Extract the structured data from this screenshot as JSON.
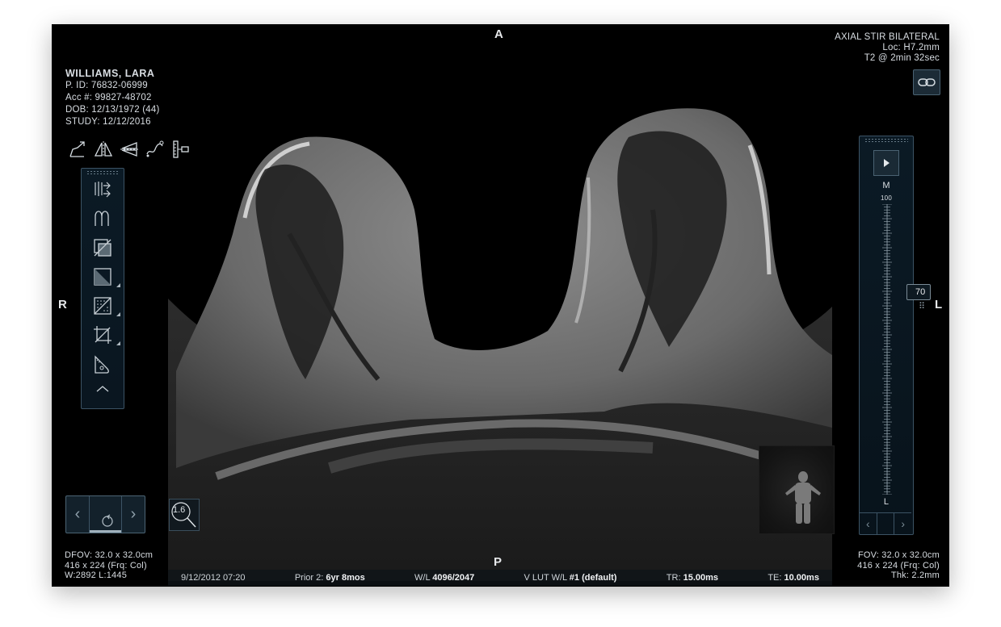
{
  "orientation": {
    "top": "A",
    "bottom": "P",
    "left": "R",
    "right": "L"
  },
  "patient": {
    "name": "WILLIAMS, LARA",
    "pid": "P. ID: 76832-06999",
    "acc": "Acc #: 99827-48702",
    "dob": "DOB: 12/13/1972 (44)",
    "study": "STUDY: 12/12/2016"
  },
  "series_info": {
    "title": "AXIAL STIR BILATERAL",
    "loc": "Loc: H7.2mm",
    "timing": "T2 @ 2min 32sec"
  },
  "bottom_left": {
    "dfov": "DFOV: 32.0 x 32.0cm",
    "matrix": "416 x 224 (Frq: Col)",
    "wl": "W:2892 L:1445"
  },
  "bottom_right": {
    "fov": "FOV: 32.0 x 32.0cm",
    "matrix": "416 x 224 (Frq: Col)",
    "thk": "Thk: 2.2mm"
  },
  "status_bar": {
    "datetime": "9/12/2012 07:20",
    "prior_label": "Prior 2:",
    "prior_value": "6yr 8mos",
    "wl_label": "W/L",
    "wl_value": "4096/2047",
    "vlut_label": "V LUT W/L",
    "vlut_value": "#1 (default)",
    "tr_label": "TR:",
    "tr_value": "15.00ms",
    "te_label": "TE:",
    "te_value": "10.00ms"
  },
  "scale": {
    "top_label": "M",
    "top_value": "100",
    "bottom_label": "L",
    "slider_value": "70",
    "slider_fraction": 0.7
  },
  "zoom_level": "1.6",
  "toolbar_icons": [
    "arrow-annotation-icon",
    "flip-horizontal-icon",
    "flip-vertical-icon",
    "curve-tool-icon",
    "ruler-icon"
  ],
  "panel_icons": [
    "mpr-icon",
    "curve-graph-icon",
    "subtraction-icon",
    "window-level-icon",
    "dither-icon",
    "crop-icon",
    "probe-icon"
  ],
  "colors": {
    "panel_border": "#3c5364",
    "panel_bg": "#0b1a25",
    "text": "#d8dde2"
  }
}
